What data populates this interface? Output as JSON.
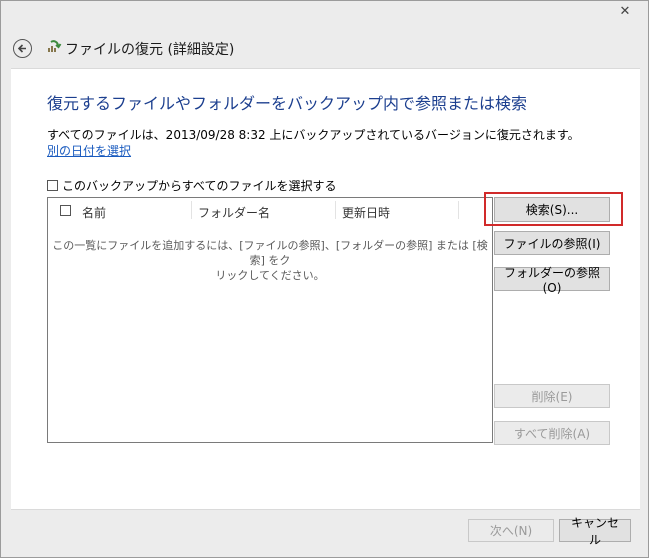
{
  "window": {
    "close_glyph": "✕"
  },
  "header": {
    "title": "ファイルの復元 (詳細設定)"
  },
  "main": {
    "heading": "復元するファイルやフォルダーをバックアップ内で参照または検索",
    "restore_info": "すべてのファイルは、2013/09/28 8:32 上にバックアップされているバージョンに復元されます。",
    "choose_date_link": "別の日付を選択",
    "select_all_label": "このバックアップからすべてのファイルを選択する"
  },
  "file_list": {
    "columns": [
      "名前",
      "フォルダー名",
      "更新日時"
    ],
    "empty_message_line1": "この一覧にファイルを追加するには、[ファイルの参照]、[フォルダーの参照] または [検索] をク",
    "empty_message_line2": "リックしてください。"
  },
  "buttons": {
    "search": "検索(S)...",
    "browse_files": "ファイルの参照(I)",
    "browse_folders": "フォルダーの参照(O)",
    "delete": "削除(E)",
    "delete_all": "すべて削除(A)"
  },
  "footer": {
    "next": "次へ(N)",
    "cancel": "キャンセル"
  },
  "colors": {
    "heading": "#1c3f8f",
    "link": "#1a5bbf",
    "highlight": "#d12a2a"
  },
  "icons": [
    "back-arrow-icon",
    "restore-app-icon",
    "close-icon",
    "checkbox-icon"
  ]
}
